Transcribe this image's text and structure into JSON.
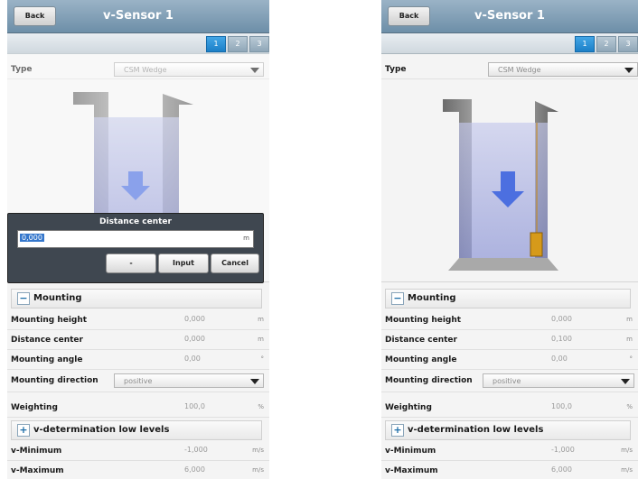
{
  "screens": [
    {
      "title": "v-Sensor 1",
      "back_label": "Back",
      "pages": [
        "1",
        "2",
        "3"
      ],
      "type_label": "Type",
      "type_value": "CSM Wedge",
      "mounting_label": "Mounting",
      "fields": [
        {
          "label": "Mounting height",
          "value": "0,000",
          "unit": "m"
        },
        {
          "label": "Distance center",
          "value": "0,000",
          "unit": "m"
        },
        {
          "label": "Mounting angle",
          "value": "0,00",
          "unit": "°"
        }
      ],
      "direction_label": "Mounting direction",
      "direction_value": "positive",
      "weighting_label": "Weighting",
      "weighting_value": "100,0",
      "weighting_unit": "%",
      "low_levels_label": "v-determination low levels",
      "vmin_label": "v-Minimum",
      "vmin_value": "-1,000",
      "vmin_unit": "m/s",
      "vmax_label": "v-Maximum",
      "vmax_value": "6,000",
      "vmax_unit": "m/s",
      "dialog": {
        "title": "Distance center",
        "input_value": "0,000",
        "input_unit": "m",
        "minus_label": "-",
        "input_label": "Input",
        "cancel_label": "Cancel"
      }
    },
    {
      "title": "v-Sensor 1",
      "back_label": "Back",
      "pages": [
        "1",
        "2",
        "3"
      ],
      "type_label": "Type",
      "type_value": "CSM Wedge",
      "mounting_label": "Mounting",
      "fields": [
        {
          "label": "Mounting height",
          "value": "0,000",
          "unit": "m"
        },
        {
          "label": "Distance center",
          "value": "0,100",
          "unit": "m"
        },
        {
          "label": "Mounting angle",
          "value": "0,00",
          "unit": "°"
        }
      ],
      "direction_label": "Mounting direction",
      "direction_value": "positive",
      "weighting_label": "Weighting",
      "weighting_value": "100,0",
      "weighting_unit": "%",
      "low_levels_label": "v-determination low levels",
      "vmin_label": "v-Minimum",
      "vmin_value": "-1,000",
      "vmin_unit": "m/s",
      "vmax_label": "v-Maximum",
      "vmax_value": "6,000",
      "vmax_unit": "m/s"
    }
  ],
  "icons": {
    "dropdown": "triangle-down-icon",
    "collapse": "minus-icon",
    "expand": "plus-icon",
    "flow": "flow-arrow-icon",
    "sensor": "sensor-icon"
  },
  "colors": {
    "titlebar": "#7b9bb2",
    "active_page": "#2d90d6",
    "dialog": "#3f4750",
    "selection": "#3577cc",
    "sensor": "#d69a1a"
  }
}
